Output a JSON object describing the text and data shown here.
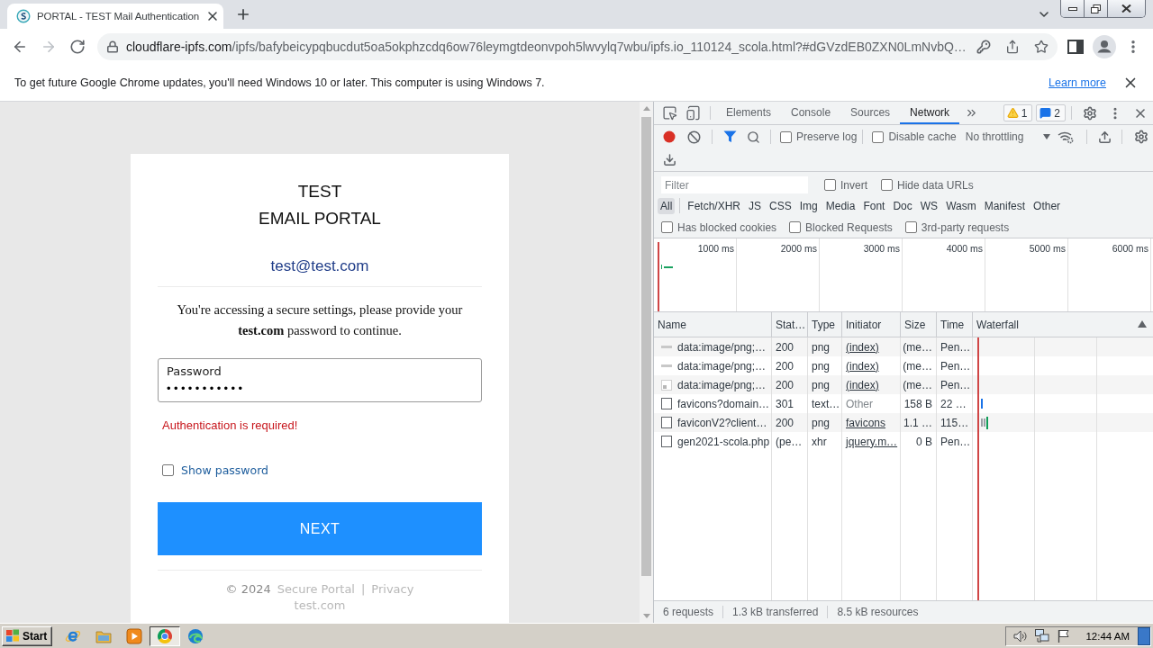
{
  "browser": {
    "tab": {
      "title": "PORTAL - TEST Mail Authentication"
    },
    "navigation": [
      {
        "kind": "back",
        "disabled": false
      },
      {
        "kind": "forward",
        "disabled": true
      },
      {
        "kind": "reload",
        "disabled": false
      }
    ],
    "address": {
      "host": "cloudflare-ipfs.com",
      "path": "/ipfs/bafybeicypqbucdut5oa5okphzcdq6ow76leymgtdeonvpoh5lwvylq7wbu/ipfs.io_110124_scola.html?#dGVzdEB0ZXN0LmNvbQ…"
    },
    "infobar": {
      "message": "To get future Google Chrome updates, you'll need Windows 10 or later. This computer is using Windows 7.",
      "link": "Learn more"
    }
  },
  "page": {
    "title_lines": [
      "TEST",
      "EMAIL PORTAL"
    ],
    "email": "test@test.com",
    "message": "You're accessing a secure settings, please provide your **test.com** password to continue.",
    "password": {
      "label": "Password",
      "value": "•••••••••••"
    },
    "error": "Authentication is required!",
    "show_password": {
      "label": "Show password",
      "checked": false
    },
    "submit": "NEXT",
    "footer": {
      "copyright": "© 2024",
      "links": [
        "Secure Portal",
        "Privacy"
      ],
      "separator": "|",
      "domain": "test.com"
    }
  },
  "devtools": {
    "tabs": [
      {
        "label": "Elements",
        "selected": false
      },
      {
        "label": "Console",
        "selected": false
      },
      {
        "label": "Sources",
        "selected": false
      },
      {
        "label": "Network",
        "selected": true
      }
    ],
    "warnings": "1",
    "messages": "2",
    "recording": true,
    "options": [
      {
        "label": "Preserve log",
        "checked": false
      },
      {
        "label": "Disable cache",
        "checked": false
      }
    ],
    "throttling": "No throttling",
    "filter": {
      "placeholder": "Filter"
    },
    "filter_options": [
      {
        "label": "Invert",
        "checked": false
      },
      {
        "label": "Hide data URLs",
        "checked": false
      }
    ],
    "types": [
      {
        "label": "All",
        "selected": true
      },
      {
        "label": "Fetch/XHR",
        "selected": false
      },
      {
        "label": "JS",
        "selected": false
      },
      {
        "label": "CSS",
        "selected": false
      },
      {
        "label": "Img",
        "selected": false
      },
      {
        "label": "Media",
        "selected": false
      },
      {
        "label": "Font",
        "selected": false
      },
      {
        "label": "Doc",
        "selected": false
      },
      {
        "label": "WS",
        "selected": false
      },
      {
        "label": "Wasm",
        "selected": false
      },
      {
        "label": "Manifest",
        "selected": false
      },
      {
        "label": "Other",
        "selected": false
      }
    ],
    "request_filters": [
      {
        "label": "Has blocked cookies",
        "checked": false
      },
      {
        "label": "Blocked Requests",
        "checked": false
      },
      {
        "label": "3rd-party requests",
        "checked": false
      }
    ],
    "overview": {
      "ticks": [
        "1000 ms",
        "2000 ms",
        "3000 ms",
        "4000 ms",
        "5000 ms",
        "6000 ms"
      ]
    },
    "table": {
      "columns": [
        {
          "label": "Name",
          "sorted": false
        },
        {
          "label": "Stat…",
          "sorted": false
        },
        {
          "label": "Type",
          "sorted": false
        },
        {
          "label": "Initiator",
          "sorted": false
        },
        {
          "label": "Size",
          "sorted": false
        },
        {
          "label": "Time",
          "sorted": false
        },
        {
          "label": "Waterfall",
          "sorted": true
        }
      ],
      "rows": [
        {
          "kind": "image-line",
          "name": "data:image/png;…",
          "status": "200",
          "type": "png",
          "initiator": "(index)",
          "initiator_link": true,
          "size": "(me…",
          "time": "Pen…"
        },
        {
          "kind": "image-line",
          "name": "data:image/png;…",
          "status": "200",
          "type": "png",
          "initiator": "(index)",
          "initiator_link": true,
          "size": "(me…",
          "time": "Pen…"
        },
        {
          "kind": "image-thumb",
          "name": "data:image/png;…",
          "status": "200",
          "type": "png",
          "initiator": "(index)",
          "initiator_link": true,
          "size": "(me…",
          "time": "Pen…"
        },
        {
          "kind": "document",
          "name": "favicons?domain…",
          "status": "301",
          "type": "text…",
          "initiator": "Other",
          "initiator_link": false,
          "size": "158 B",
          "time": "22 …",
          "bars": [
            {
              "kind": "download"
            }
          ]
        },
        {
          "kind": "document",
          "name": "faviconV2?client…",
          "status": "200",
          "type": "png",
          "initiator": "favicons",
          "initiator_link": true,
          "size": "1.1 …",
          "time": "115…",
          "bars": [
            {
              "kind": "queued"
            },
            {
              "kind": "queued"
            },
            {
              "kind": "waiting"
            }
          ]
        },
        {
          "kind": "document",
          "name": "gen2021-scola.php",
          "status": "(pe…",
          "type": "xhr",
          "initiator": "jquery.m…",
          "initiator_link": true,
          "size": "0 B",
          "time": "Pen…"
        }
      ]
    },
    "summary": [
      "6 requests",
      "1.3 kB transferred",
      "8.5 kB resources"
    ]
  },
  "taskbar": {
    "start": "Start",
    "apps": [
      {
        "kind": "ie",
        "selected": false
      },
      {
        "kind": "folder",
        "selected": false
      },
      {
        "kind": "media",
        "selected": false
      },
      {
        "kind": "chrome",
        "selected": true
      },
      {
        "kind": "edge",
        "selected": false
      }
    ],
    "clock": "12:44 AM"
  }
}
